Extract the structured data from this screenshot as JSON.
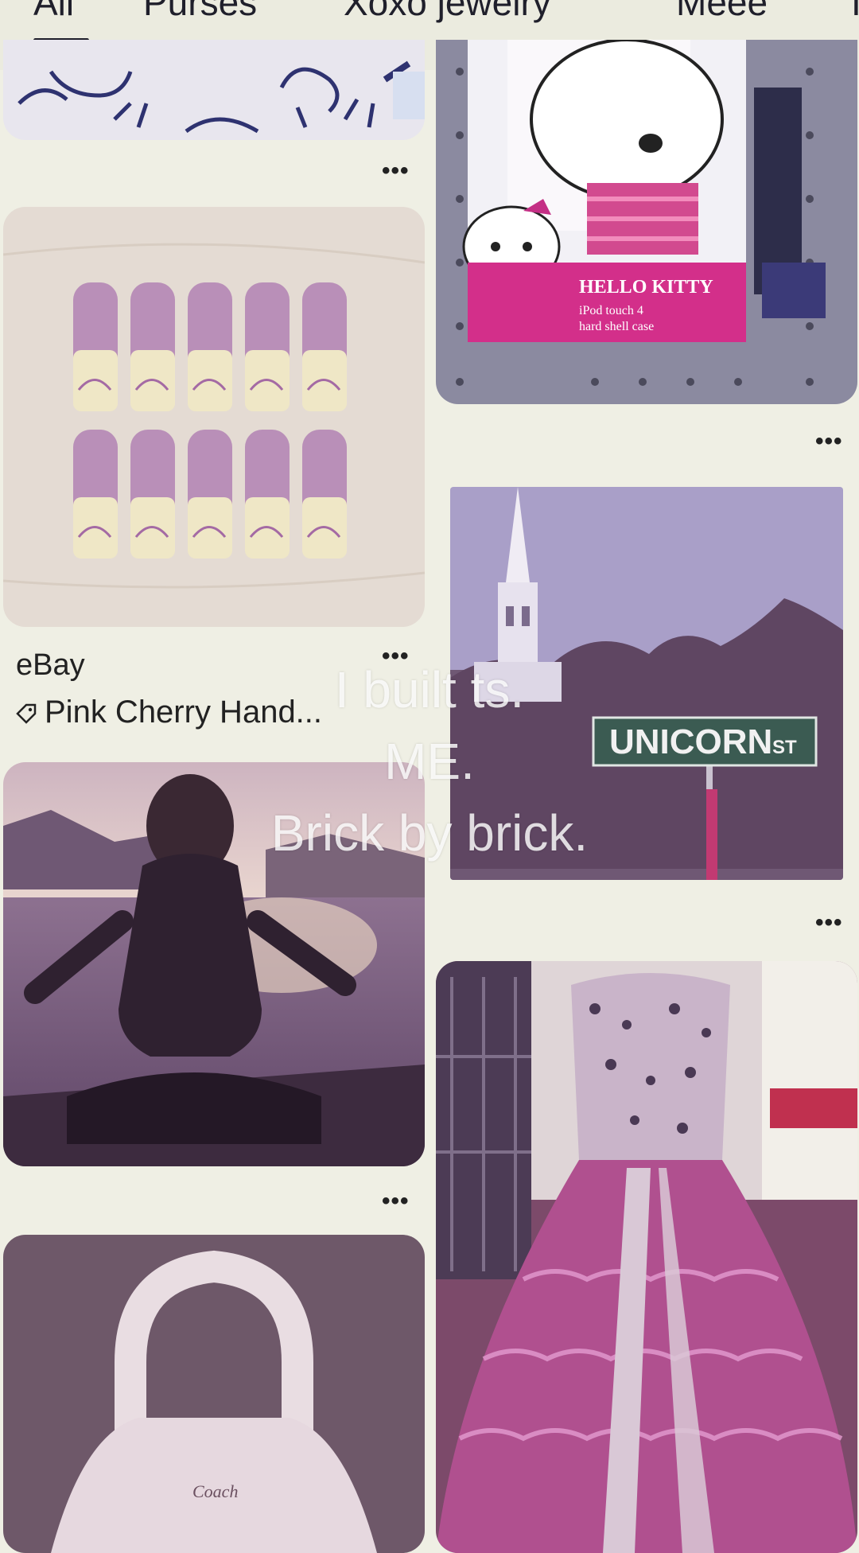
{
  "tabs": [
    {
      "label": "All"
    },
    {
      "label": "Purses"
    },
    {
      "label": "Xoxo jewelry"
    },
    {
      "label": "Meee"
    },
    {
      "label": "I"
    }
  ],
  "pins": {
    "nails": {
      "source": "eBay",
      "title": "Pink Cherry Hand..."
    },
    "iphone_case": {
      "brand_text": "HELLO KITTY",
      "product_text": "iPod touch 4",
      "product_text_2": "hard shell case"
    },
    "street_sign": {
      "sign_text": "UNICORN",
      "sign_suffix": "ST"
    },
    "purse": {
      "brand_text": "Coach"
    }
  },
  "overlay": {
    "line1": "I built ts.",
    "line2": "ME.",
    "line3": "Brick by brick."
  },
  "more_label": "•••"
}
